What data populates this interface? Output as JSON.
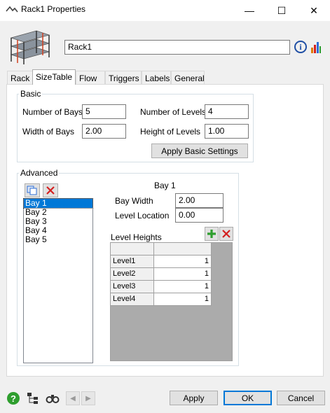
{
  "window": {
    "title": "Rack1  Properties",
    "minimize": "—",
    "maximize": "☐",
    "close": "✕"
  },
  "object": {
    "name": "Rack1"
  },
  "tabs": [
    {
      "label": "Rack"
    },
    {
      "label": "SizeTable"
    },
    {
      "label": "Flow"
    },
    {
      "label": "Triggers"
    },
    {
      "label": "Labels"
    },
    {
      "label": "General"
    }
  ],
  "basic": {
    "group_label": "Basic",
    "num_bays_label": "Number of Bays",
    "num_bays_value": "5",
    "width_bays_label": "Width of Bays",
    "width_bays_value": "2.00",
    "num_levels_label": "Number of Levels",
    "num_levels_value": "4",
    "height_levels_label": "Height of Levels",
    "height_levels_value": "1.00",
    "apply_button": "Apply Basic Settings"
  },
  "advanced": {
    "group_label": "Advanced",
    "bays": [
      "Bay 1",
      "Bay 2",
      "Bay 3",
      "Bay 4",
      "Bay 5"
    ],
    "selected_bay": "Bay 1",
    "bay_title": "Bay 1",
    "bay_width_label": "Bay Width",
    "bay_width_value": "2.00",
    "level_location_label": "Level Location",
    "level_location_value": "0.00",
    "level_heights_label": "Level Heights",
    "levels": [
      {
        "name": "Level1",
        "value": "1"
      },
      {
        "name": "Level2",
        "value": "1"
      },
      {
        "name": "Level3",
        "value": "1"
      },
      {
        "name": "Level4",
        "value": "1"
      }
    ]
  },
  "footer": {
    "apply": "Apply",
    "ok": "OK",
    "cancel": "Cancel"
  },
  "colors": {
    "accent": "#0078d7",
    "add": "#2e9e2e",
    "delete": "#d42020"
  },
  "icons": [
    "rack-icon",
    "info-icon",
    "chart-icon",
    "copy-icon",
    "delete-icon",
    "add-icon",
    "help-icon",
    "tree-icon",
    "find-icon",
    "back-icon",
    "forward-icon"
  ]
}
